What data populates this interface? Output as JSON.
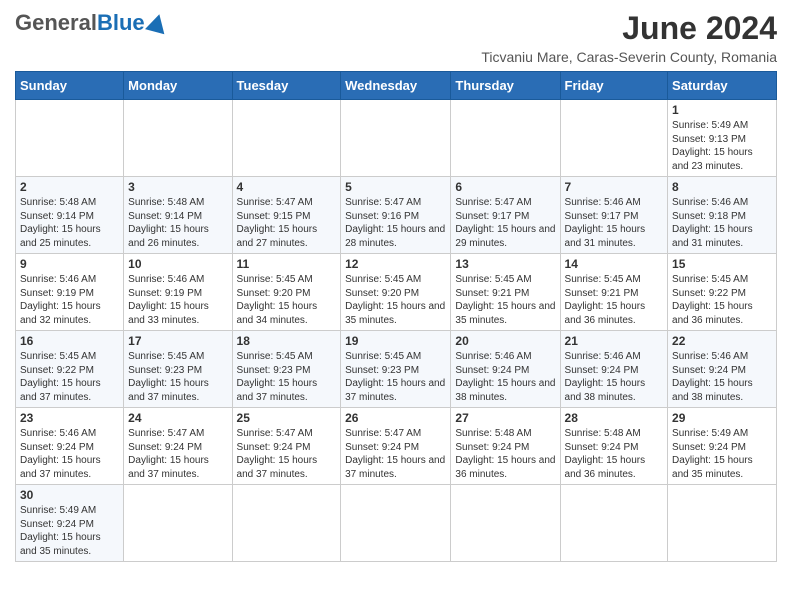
{
  "logo": {
    "general": "General",
    "blue": "Blue"
  },
  "title": {
    "month_year": "June 2024",
    "subtitle": "Ticvaniu Mare, Caras-Severin County, Romania"
  },
  "weekdays": [
    "Sunday",
    "Monday",
    "Tuesday",
    "Wednesday",
    "Thursday",
    "Friday",
    "Saturday"
  ],
  "weeks": [
    [
      {
        "day": "",
        "info": ""
      },
      {
        "day": "",
        "info": ""
      },
      {
        "day": "",
        "info": ""
      },
      {
        "day": "",
        "info": ""
      },
      {
        "day": "",
        "info": ""
      },
      {
        "day": "",
        "info": ""
      },
      {
        "day": "1",
        "info": "Sunrise: 5:49 AM\nSunset: 9:13 PM\nDaylight: 15 hours\nand 23 minutes."
      }
    ],
    [
      {
        "day": "2",
        "info": "Sunrise: 5:48 AM\nSunset: 9:14 PM\nDaylight: 15 hours\nand 25 minutes."
      },
      {
        "day": "3",
        "info": "Sunrise: 5:48 AM\nSunset: 9:14 PM\nDaylight: 15 hours\nand 26 minutes."
      },
      {
        "day": "4",
        "info": "Sunrise: 5:47 AM\nSunset: 9:15 PM\nDaylight: 15 hours\nand 27 minutes."
      },
      {
        "day": "5",
        "info": "Sunrise: 5:47 AM\nSunset: 9:16 PM\nDaylight: 15 hours\nand 28 minutes."
      },
      {
        "day": "6",
        "info": "Sunrise: 5:47 AM\nSunset: 9:17 PM\nDaylight: 15 hours\nand 29 minutes."
      },
      {
        "day": "7",
        "info": "Sunrise: 5:46 AM\nSunset: 9:17 PM\nDaylight: 15 hours\nand 31 minutes."
      },
      {
        "day": "8",
        "info": "Sunrise: 5:46 AM\nSunset: 9:18 PM\nDaylight: 15 hours\nand 31 minutes."
      }
    ],
    [
      {
        "day": "9",
        "info": "Sunrise: 5:46 AM\nSunset: 9:19 PM\nDaylight: 15 hours\nand 32 minutes."
      },
      {
        "day": "10",
        "info": "Sunrise: 5:46 AM\nSunset: 9:19 PM\nDaylight: 15 hours\nand 33 minutes."
      },
      {
        "day": "11",
        "info": "Sunrise: 5:45 AM\nSunset: 9:20 PM\nDaylight: 15 hours\nand 34 minutes."
      },
      {
        "day": "12",
        "info": "Sunrise: 5:45 AM\nSunset: 9:20 PM\nDaylight: 15 hours\nand 35 minutes."
      },
      {
        "day": "13",
        "info": "Sunrise: 5:45 AM\nSunset: 9:21 PM\nDaylight: 15 hours\nand 35 minutes."
      },
      {
        "day": "14",
        "info": "Sunrise: 5:45 AM\nSunset: 9:21 PM\nDaylight: 15 hours\nand 36 minutes."
      },
      {
        "day": "15",
        "info": "Sunrise: 5:45 AM\nSunset: 9:22 PM\nDaylight: 15 hours\nand 36 minutes."
      }
    ],
    [
      {
        "day": "16",
        "info": "Sunrise: 5:45 AM\nSunset: 9:22 PM\nDaylight: 15 hours\nand 37 minutes."
      },
      {
        "day": "17",
        "info": "Sunrise: 5:45 AM\nSunset: 9:23 PM\nDaylight: 15 hours\nand 37 minutes."
      },
      {
        "day": "18",
        "info": "Sunrise: 5:45 AM\nSunset: 9:23 PM\nDaylight: 15 hours\nand 37 minutes."
      },
      {
        "day": "19",
        "info": "Sunrise: 5:45 AM\nSunset: 9:23 PM\nDaylight: 15 hours\nand 37 minutes."
      },
      {
        "day": "20",
        "info": "Sunrise: 5:46 AM\nSunset: 9:24 PM\nDaylight: 15 hours\nand 38 minutes."
      },
      {
        "day": "21",
        "info": "Sunrise: 5:46 AM\nSunset: 9:24 PM\nDaylight: 15 hours\nand 38 minutes."
      },
      {
        "day": "22",
        "info": "Sunrise: 5:46 AM\nSunset: 9:24 PM\nDaylight: 15 hours\nand 38 minutes."
      }
    ],
    [
      {
        "day": "23",
        "info": "Sunrise: 5:46 AM\nSunset: 9:24 PM\nDaylight: 15 hours\nand 37 minutes."
      },
      {
        "day": "24",
        "info": "Sunrise: 5:47 AM\nSunset: 9:24 PM\nDaylight: 15 hours\nand 37 minutes."
      },
      {
        "day": "25",
        "info": "Sunrise: 5:47 AM\nSunset: 9:24 PM\nDaylight: 15 hours\nand 37 minutes."
      },
      {
        "day": "26",
        "info": "Sunrise: 5:47 AM\nSunset: 9:24 PM\nDaylight: 15 hours\nand 37 minutes."
      },
      {
        "day": "27",
        "info": "Sunrise: 5:48 AM\nSunset: 9:24 PM\nDaylight: 15 hours\nand 36 minutes."
      },
      {
        "day": "28",
        "info": "Sunrise: 5:48 AM\nSunset: 9:24 PM\nDaylight: 15 hours\nand 36 minutes."
      },
      {
        "day": "29",
        "info": "Sunrise: 5:49 AM\nSunset: 9:24 PM\nDaylight: 15 hours\nand 35 minutes."
      }
    ],
    [
      {
        "day": "30",
        "info": "Sunrise: 5:49 AM\nSunset: 9:24 PM\nDaylight: 15 hours\nand 35 minutes."
      },
      {
        "day": "",
        "info": ""
      },
      {
        "day": "",
        "info": ""
      },
      {
        "day": "",
        "info": ""
      },
      {
        "day": "",
        "info": ""
      },
      {
        "day": "",
        "info": ""
      },
      {
        "day": "",
        "info": ""
      }
    ]
  ]
}
